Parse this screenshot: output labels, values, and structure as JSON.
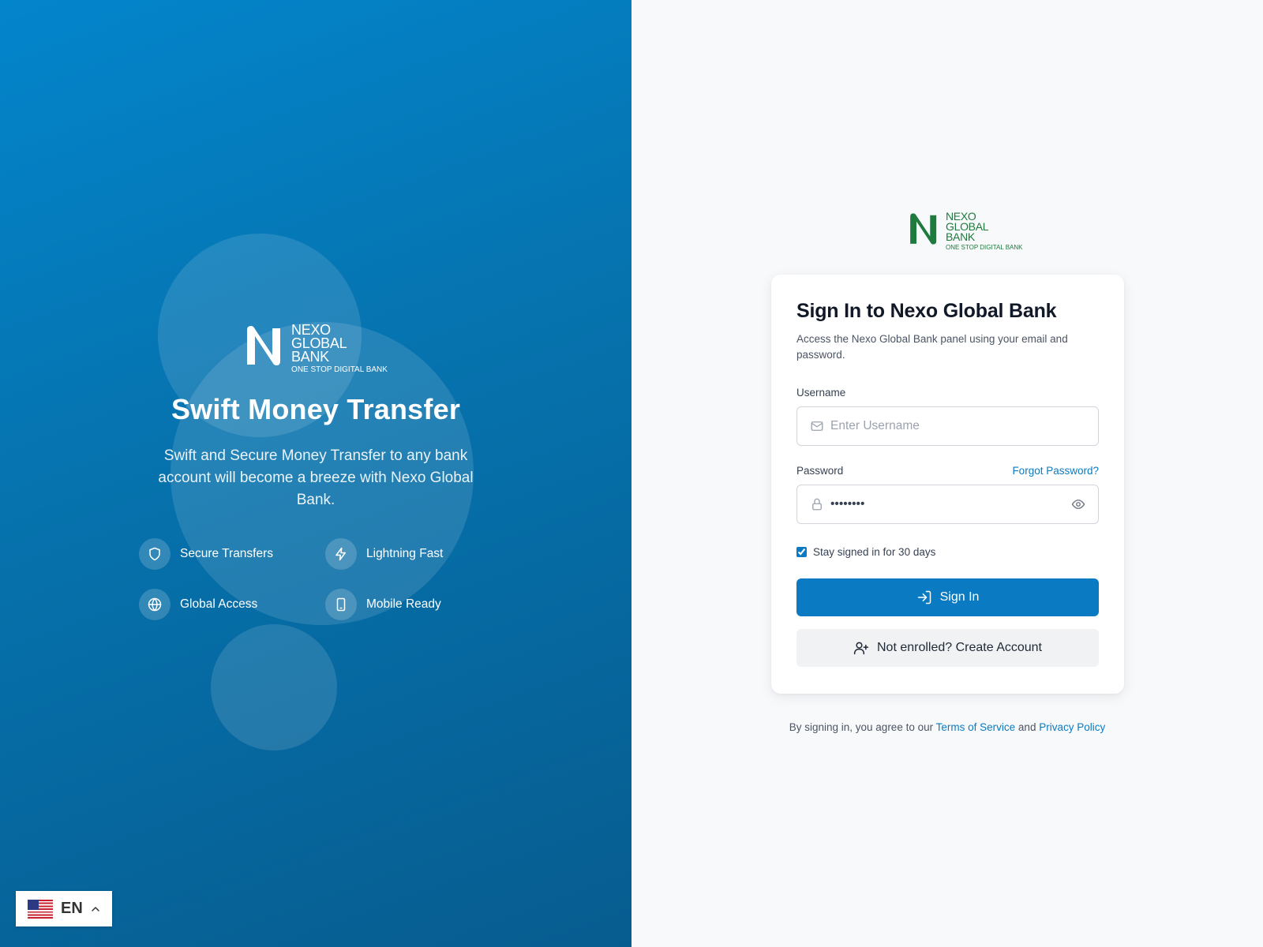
{
  "brand": {
    "name_lines": [
      "NEXO",
      "GLOBAL",
      "BANK"
    ],
    "tagline": "ONE STOP DIGITAL BANK"
  },
  "hero": {
    "title": "Swift Money Transfer",
    "description": "Swift and Secure Money Transfer to any bank account will become a breeze with Nexo Global Bank.",
    "features": [
      {
        "label": "Secure Transfers",
        "icon": "shield-icon"
      },
      {
        "label": "Lightning Fast",
        "icon": "lightning-icon"
      },
      {
        "label": "Global Access",
        "icon": "globe-icon"
      },
      {
        "label": "Mobile Ready",
        "icon": "mobile-icon"
      }
    ]
  },
  "language": {
    "code": "EN",
    "flag": "us-flag-icon"
  },
  "signin": {
    "title": "Sign In to Nexo Global Bank",
    "subtitle": "Access the Nexo Global Bank panel using your email and password.",
    "username": {
      "label": "Username",
      "placeholder": "Enter Username",
      "value": ""
    },
    "password": {
      "label": "Password",
      "value": "••••••••",
      "forgot_label": "Forgot Password?"
    },
    "stay_signed_in": {
      "label": "Stay signed in for 30 days",
      "checked": true
    },
    "submit_label": "Sign In",
    "create_account_label": "Not enrolled? Create Account"
  },
  "legal": {
    "prefix": "By signing in, you agree to our",
    "terms_label": "Terms of Service",
    "and": "and",
    "privacy_label": "Privacy Policy"
  },
  "colors": {
    "primary": "#0a7bc2",
    "hero_gradient_start": "#0385cc",
    "hero_gradient_end": "#075c8f",
    "brand_green": "#1e7a3d"
  }
}
